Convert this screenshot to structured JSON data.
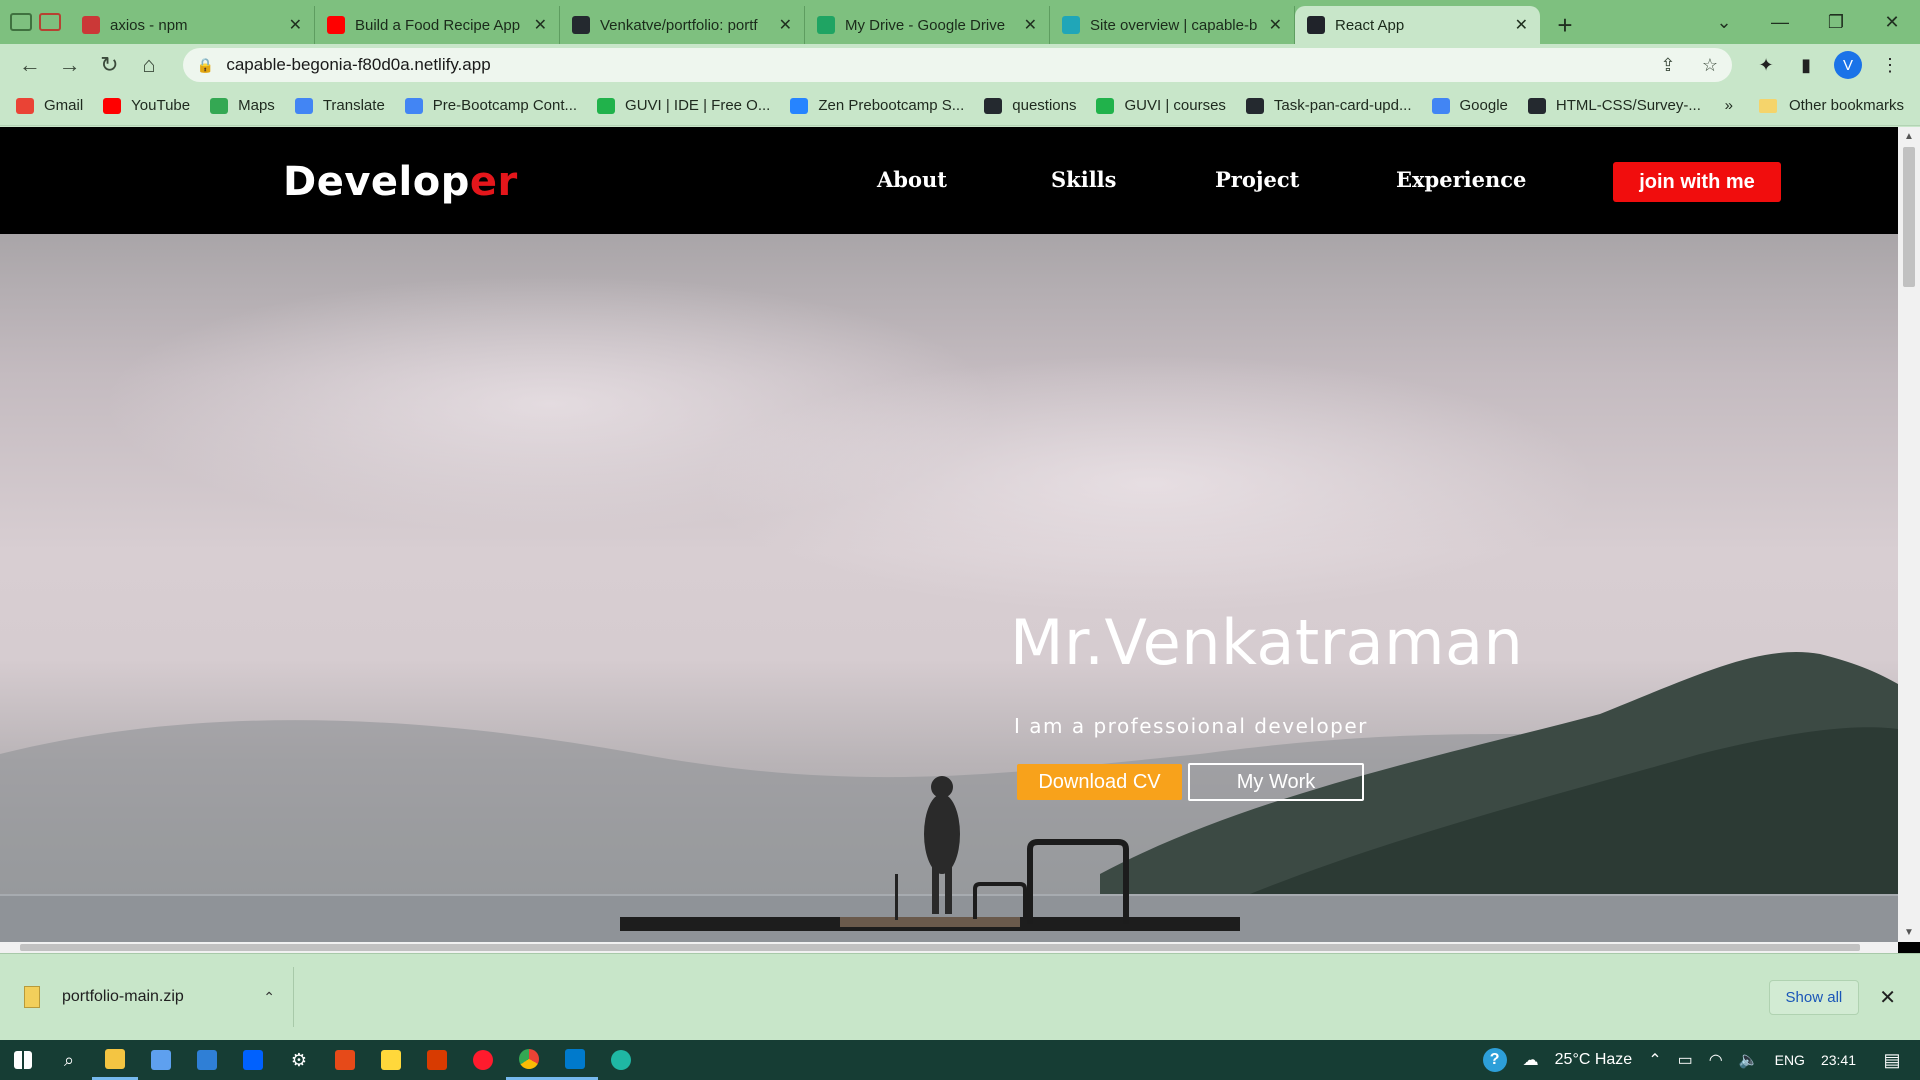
{
  "browser": {
    "tabs": [
      {
        "title": "axios - npm",
        "icon": "npm-icon",
        "color": "#cb3837",
        "active": false
      },
      {
        "title": "Build a Food Recipe App",
        "icon": "youtube-icon",
        "color": "#ff0000",
        "active": false
      },
      {
        "title": "Venkatve/portfolio: portf",
        "icon": "github-icon",
        "color": "#24292f",
        "active": false
      },
      {
        "title": "My Drive - Google Drive",
        "icon": "google-drive-icon",
        "color": "#1fa463",
        "active": false
      },
      {
        "title": "Site overview | capable-b",
        "icon": "netlify-icon",
        "color": "#20a6b8",
        "active": false
      },
      {
        "title": "React App",
        "icon": "react-icon",
        "color": "#20232a",
        "active": true
      }
    ],
    "new_tab_glyph": "+",
    "url": "capable-begonia-f80d0a.netlify.app",
    "profile_initial": "V"
  },
  "bookmarks": [
    {
      "label": "Gmail",
      "icon": "gmail-icon",
      "color": "#ea4335"
    },
    {
      "label": "YouTube",
      "icon": "youtube-icon",
      "color": "#ff0000"
    },
    {
      "label": "Maps",
      "icon": "maps-icon",
      "color": "#34a853"
    },
    {
      "label": "Translate",
      "icon": "translate-icon",
      "color": "#4285f4"
    },
    {
      "label": "Pre-Bootcamp Cont...",
      "icon": "docs-icon",
      "color": "#4285f4"
    },
    {
      "label": "GUVI | IDE | Free O...",
      "icon": "guvi-icon",
      "color": "#21b24b"
    },
    {
      "label": "Zen Prebootcamp S...",
      "icon": "jira-icon",
      "color": "#2684ff"
    },
    {
      "label": "questions",
      "icon": "github-icon",
      "color": "#24292f"
    },
    {
      "label": "GUVI | courses",
      "icon": "guvi-icon",
      "color": "#21b24b"
    },
    {
      "label": "Task-pan-card-upd...",
      "icon": "github-icon",
      "color": "#24292f"
    },
    {
      "label": "Google",
      "icon": "google-icon",
      "color": "#4285f4"
    },
    {
      "label": "HTML-CSS/Survey-...",
      "icon": "github-icon",
      "color": "#24292f"
    }
  ],
  "bookmarks_more": "»",
  "other_bookmarks": "Other bookmarks",
  "site": {
    "logo_main": "Develop",
    "logo_accent": "er",
    "nav": [
      "About",
      "Skills",
      "Project",
      "Experience"
    ],
    "cta": "join with me",
    "hero_name": "Mr.Venkatraman",
    "hero_subtitle": "I am a professoional developer",
    "btn_download": "Download CV",
    "btn_work": "My Work",
    "colors": {
      "accent_red": "#f10d0d",
      "download_orange": "#f8a21b"
    }
  },
  "downloads": {
    "file": "portfolio-main.zip",
    "show_all": "Show all"
  },
  "taskbar": {
    "weather": "25°C  Haze",
    "language": "ENG",
    "time": "23:41"
  }
}
